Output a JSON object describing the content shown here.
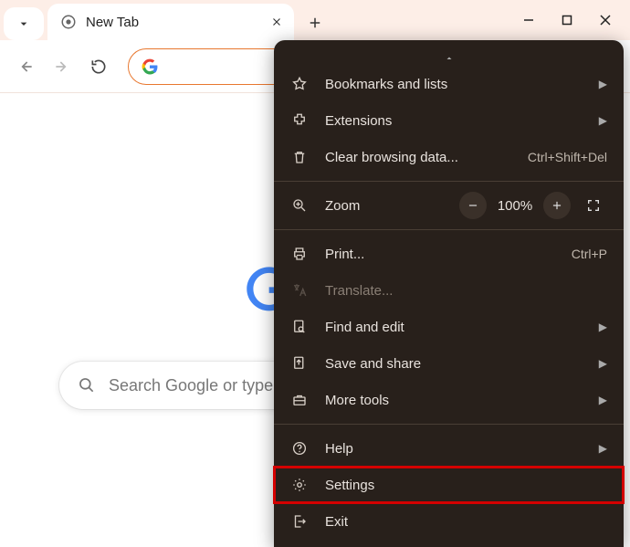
{
  "window": {
    "tab_title": "New Tab"
  },
  "omnibox": {
    "value": ""
  },
  "content": {
    "search_hint": "Search Google or type a URL"
  },
  "menu": {
    "bookmarks": "Bookmarks and lists",
    "extensions": "Extensions",
    "clear_data": "Clear browsing data...",
    "clear_data_shortcut": "Ctrl+Shift+Del",
    "zoom_label": "Zoom",
    "zoom_value": "100%",
    "print": "Print...",
    "print_shortcut": "Ctrl+P",
    "translate": "Translate...",
    "find_edit": "Find and edit",
    "save_share": "Save and share",
    "more_tools": "More tools",
    "help": "Help",
    "settings": "Settings",
    "exit": "Exit"
  }
}
